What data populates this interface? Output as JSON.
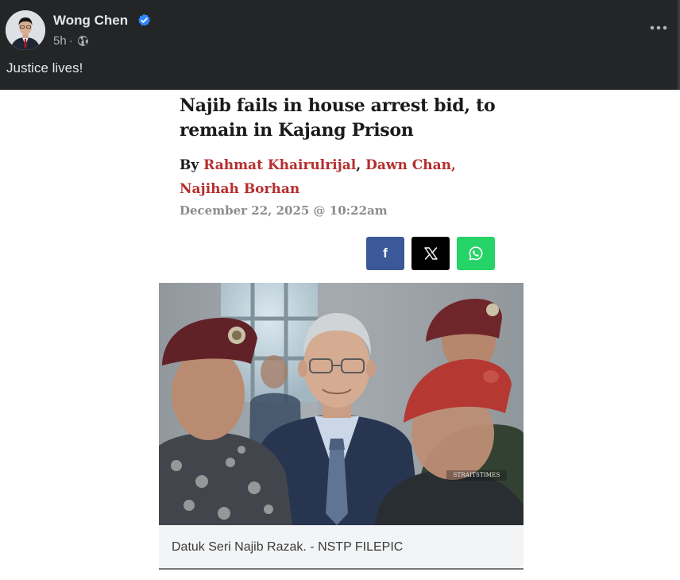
{
  "post": {
    "author": "Wong Chen",
    "time": "5h",
    "meta_separator": "·",
    "text": "Justice lives!",
    "verified": true,
    "icons": {
      "verified": "verified-badge-icon",
      "audience": "globe-icon",
      "more": "more-options-icon"
    }
  },
  "article": {
    "title_line1": "Najib fails in house arrest bid, to",
    "title_line2": "remain in Kajang Prison",
    "by_label": "By",
    "authors": [
      "Rahmat Khairulrijal",
      "Dawn Chan,",
      "Najihah Borhan"
    ],
    "author_separator": ",",
    "date": "December 22, 2025 @ 10:22am",
    "share": {
      "facebook": "f",
      "x": "𝕏"
    },
    "photo": {
      "watermark": "STRAITSTIMES",
      "caption": "Datuk Seri Najib Razak. - NSTP FILEPIC"
    }
  },
  "colors": {
    "header_bg": "#242526",
    "header_text": "#e4e6eb",
    "author_link": "#b62e2e",
    "facebook": "#3b5998",
    "x": "#000000",
    "whatsapp": "#25d366",
    "verified": "#2d88ff"
  }
}
